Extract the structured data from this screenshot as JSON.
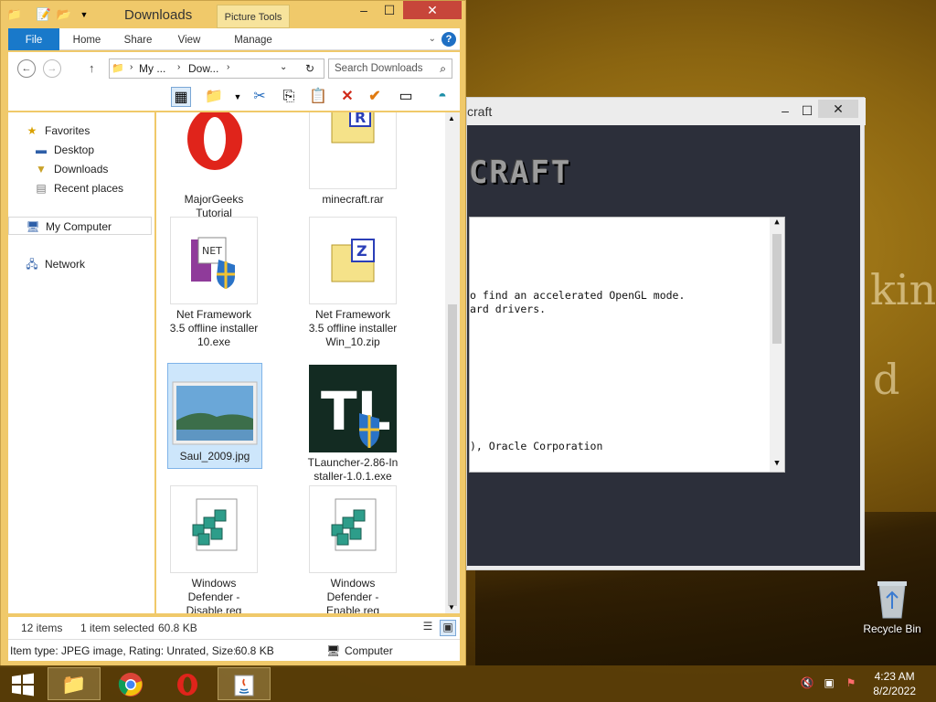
{
  "desktop": {
    "bg_text_1": "king",
    "bg_text_2": "d",
    "recycle_bin_label": "Recycle Bin"
  },
  "explorer": {
    "title": "Downloads",
    "contextual_tab": "Picture Tools",
    "ribbon_tabs": [
      "File",
      "Home",
      "Share",
      "View",
      "Manage"
    ],
    "address": {
      "seg1": "My ...",
      "seg2": "Dow..."
    },
    "search_placeholder": "Search Downloads",
    "nav": {
      "favorites": "Favorites",
      "desktop": "Desktop",
      "downloads": "Downloads",
      "recent": "Recent places",
      "computer": "My Computer",
      "network": "Network"
    },
    "files": [
      {
        "name": "MajorGeeks Tutorial Link.html",
        "icon": "opera-icon"
      },
      {
        "name": "minecraft.rar",
        "icon": "rar-archive-icon"
      },
      {
        "name": "Net Framework 3.5 offline installer 10.exe",
        "icon": "installer-icon"
      },
      {
        "name": "Net Framework 3.5 offline installer Win_10.zip",
        "icon": "zip-archive-icon"
      },
      {
        "name": "Saul_2009.jpg",
        "icon": "image-thumbnail"
      },
      {
        "name": "TLauncher-2.86-Installer-1.0.1.exe",
        "icon": "tlauncher-icon"
      },
      {
        "name": "Windows Defender - Disable.reg",
        "icon": "registry-icon"
      },
      {
        "name": "Windows Defender - Enable.reg",
        "icon": "registry-icon"
      }
    ],
    "status": {
      "item_count": "12 items",
      "selection": "1 item selected",
      "size": "60.8 KB"
    },
    "details": {
      "text": "Item type: JPEG image, Rating: Unrated, Size: 60.8",
      "size": "60.8 KB",
      "location": "Computer"
    }
  },
  "minecraft": {
    "title": "craft",
    "logo": "CRAFT",
    "lines": [
      "o find an accelerated OpenGL mode.",
      "ard drivers.",
      "), Oracle Corporation"
    ]
  },
  "taskbar": {
    "time": "4:23 AM",
    "date": "8/2/2022"
  }
}
